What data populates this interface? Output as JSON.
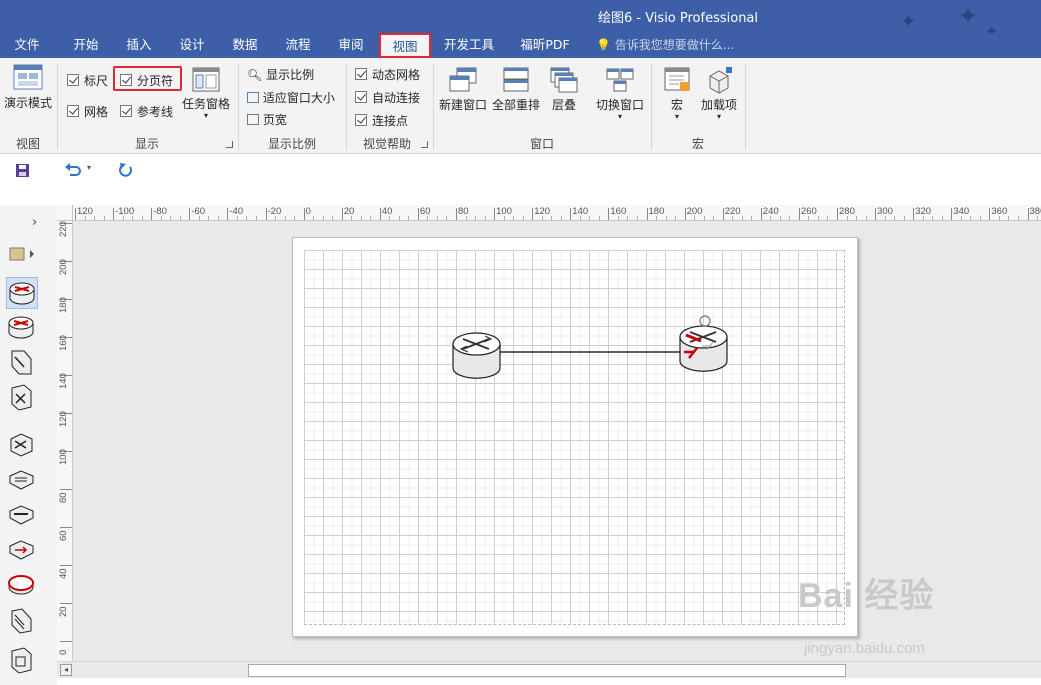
{
  "window": {
    "title": "绘图6 - Visio Professional"
  },
  "tabs": [
    {
      "label": "文件",
      "active": false
    },
    {
      "label": "开始",
      "active": false
    },
    {
      "label": "插入",
      "active": false
    },
    {
      "label": "设计",
      "active": false
    },
    {
      "label": "数据",
      "active": false
    },
    {
      "label": "流程",
      "active": false
    },
    {
      "label": "审阅",
      "active": false
    },
    {
      "label": "视图",
      "active": true
    },
    {
      "label": "开发工具",
      "active": false
    },
    {
      "label": "福昕PDF",
      "active": false
    }
  ],
  "tell_me": "告诉我您想要做什么...",
  "ribbon": {
    "view_group": {
      "presentation_mode": "演示模式",
      "label": "视图"
    },
    "show_group": {
      "ruler": "标尺",
      "page_breaks": "分页符",
      "grid": "网格",
      "guides": "参考线",
      "task_panes": "任务窗格",
      "label": "显示"
    },
    "zoom_group": {
      "zoom": "显示比例",
      "fit_to_window": "适应窗口大小",
      "page_width": "页宽",
      "label": "显示比例"
    },
    "visual_aids_group": {
      "dynamic_grid": "动态网格",
      "autoconnect": "自动连接",
      "connection_points": "连接点",
      "label": "视觉帮助"
    },
    "window_group": {
      "new_window": "新建窗口",
      "arrange_all": "全部重排",
      "cascade": "层叠",
      "switch_windows": "切换窗口",
      "label": "窗口"
    },
    "macros_group": {
      "macros": "宏",
      "add_ons": "加载项",
      "label": "宏"
    }
  },
  "ruler": {
    "top_ticks": [
      "120",
      "-100",
      "-80",
      "-60",
      "-40",
      "-20",
      "0",
      "20",
      "40",
      "60",
      "80",
      "100",
      "120",
      "140",
      "160",
      "180",
      "200",
      "220",
      "240",
      "260",
      "280",
      "300",
      "320",
      "340",
      "360",
      "380"
    ],
    "left_ticks": [
      "220",
      "200",
      "180",
      "160",
      "140",
      "120",
      "100",
      "80",
      "60",
      "40",
      "20",
      "0"
    ]
  },
  "watermark": {
    "main": "Bai 经验",
    "sub": "jingyan.baidu.com"
  },
  "colors": {
    "title_bar": "#3c5fa8",
    "highlight": "#e0282e",
    "ribbon_bg": "#f3f3f3",
    "canvas_bg": "#e9e9e9"
  }
}
